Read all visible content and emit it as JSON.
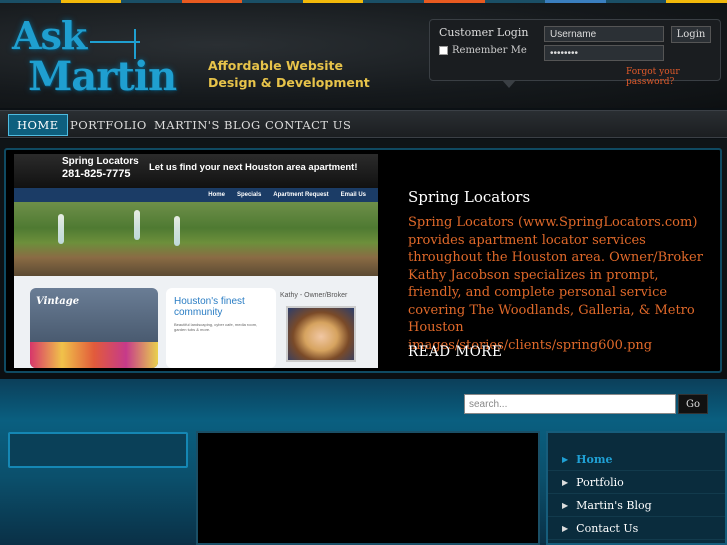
{
  "header": {
    "logo_ask": "Ask",
    "logo_martin": "Martin",
    "tagline_line1": "Affordable Website",
    "tagline_line2": "Design & Development"
  },
  "login": {
    "title": "Customer Login",
    "remember_label": "Remember Me",
    "username_value": "Username",
    "password_value": "••••••••",
    "login_button": "Login",
    "forgot_link": "Forgot your password?"
  },
  "nav": {
    "items": [
      {
        "label": "HOME",
        "active": true
      },
      {
        "label": "PORTFOLIO",
        "active": false
      },
      {
        "label": "MARTIN'S BLOG",
        "active": false
      },
      {
        "label": "CONTACT US",
        "active": false
      }
    ]
  },
  "feature": {
    "title": "Spring Locators",
    "description": "Spring Locators (www.SpringLocators.com) provides apartment locator services throughout the Houston area.  Owner/Broker Kathy Jacobson specializes in prompt, friendly, and complete personal service covering The Woodlands, Galleria, & Metro Houston images/stories/clients/spring600.png",
    "read_more": "READ MORE",
    "screenshot": {
      "brand": "Spring Locators",
      "phone": "281-825-7775",
      "message": "Let us find your next Houston area apartment!",
      "menu": [
        "Home",
        "Specials",
        "Apartment Request",
        "Email Us"
      ],
      "card_title": "Vintage",
      "finest_heading": "Houston's finest community",
      "finest_text": "Beautiful landscaping, cyber cafe, media room, garden tubs & more.",
      "kathy_label": "Kathy - Owner/Broker"
    }
  },
  "search": {
    "placeholder": "search...",
    "button": "Go"
  },
  "sidebar": {
    "items": [
      {
        "label": "Home",
        "active": true
      },
      {
        "label": "Portfolio",
        "active": false
      },
      {
        "label": "Martin's Blog",
        "active": false
      },
      {
        "label": "Contact Us",
        "active": false
      }
    ]
  },
  "colors": {
    "accent_blue": "#1f9fd0",
    "tagline_gold": "#e7c34a",
    "feature_orange": "#e0692a",
    "strip": [
      "#1a4f66",
      "#f2b90a",
      "#1a4f66",
      "#e85a20",
      "#1a4f66",
      "#f2b90a",
      "#1a4f66",
      "#e85a20",
      "#1a4f66",
      "#3a7fbf",
      "#1a4f66",
      "#f2b90a"
    ]
  }
}
